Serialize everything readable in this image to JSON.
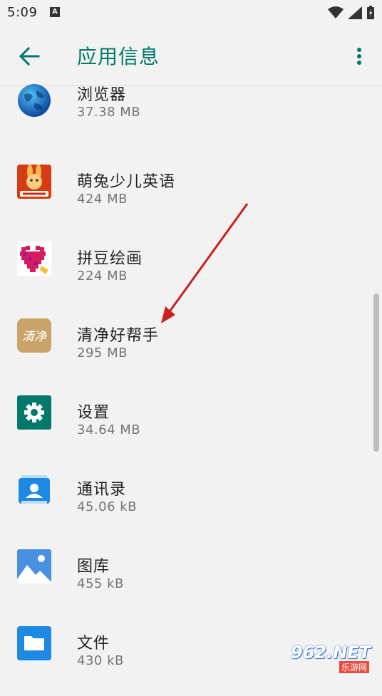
{
  "status_bar": {
    "time": "5:09",
    "notification_letter": "A"
  },
  "header": {
    "title": "应用信息"
  },
  "apps": [
    {
      "name": "浏览器",
      "size": "37.38 MB",
      "icon": "globe-icon"
    },
    {
      "name": "萌兔少儿英语",
      "size": "424 MB",
      "icon": "rabbit-icon"
    },
    {
      "name": "拼豆绘画",
      "size": "224 MB",
      "icon": "pixel-heart-icon"
    },
    {
      "name": "清净好帮手",
      "size": "295 MB",
      "icon": "cleaner-icon"
    },
    {
      "name": "设置",
      "size": "34.64 MB",
      "icon": "gear-icon"
    },
    {
      "name": "通讯录",
      "size": "45.06 kB",
      "icon": "contacts-icon"
    },
    {
      "name": "图库",
      "size": "455 kB",
      "icon": "gallery-icon"
    },
    {
      "name": "文件",
      "size": "430 kB",
      "icon": "folder-icon"
    }
  ],
  "watermark": {
    "number": "962.NET",
    "text": "乐游网"
  },
  "colors": {
    "accent": "#00796b",
    "annotation_arrow": "#cc1f1f"
  }
}
